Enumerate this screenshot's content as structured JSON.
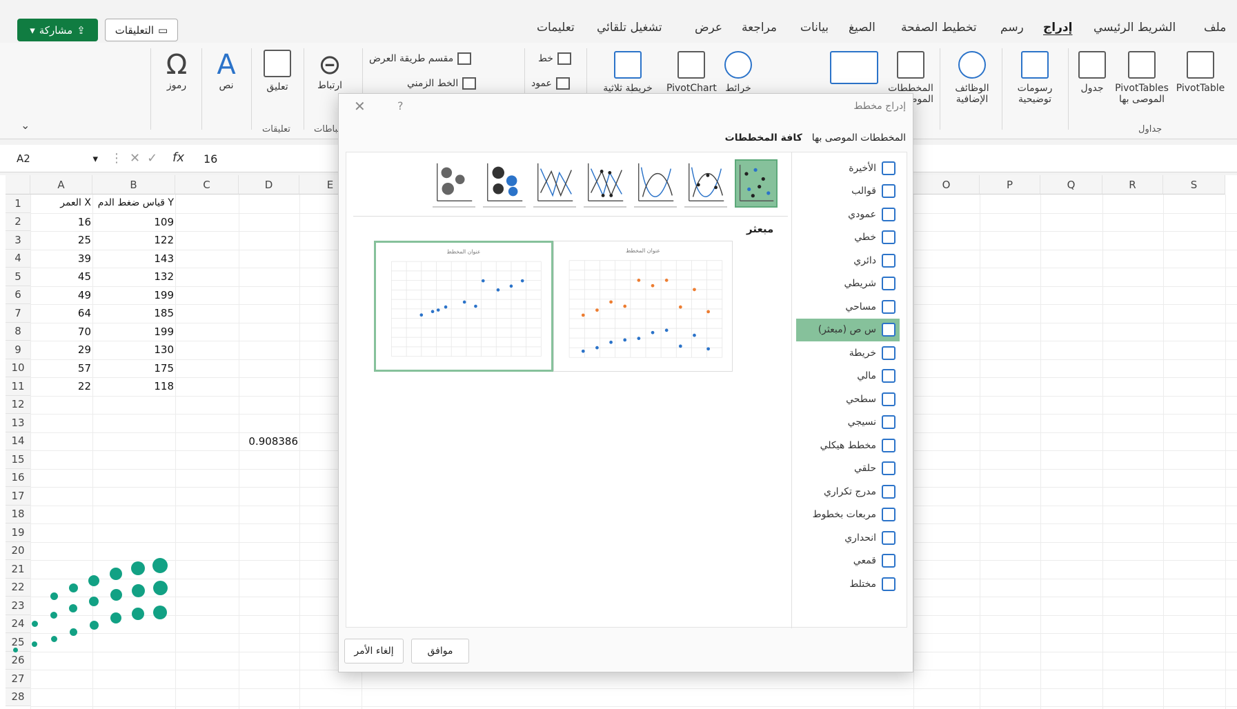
{
  "tabs": [
    "ملف",
    "الشريط الرئيسي",
    "إدراج",
    "رسم",
    "تخطيط الصفحة",
    "الصيغ",
    "بيانات",
    "مراجعة",
    "عرض",
    "تشغيل تلقائي",
    "تعليمات"
  ],
  "active_tab": "إدراج",
  "share_label": "مشاركة",
  "comments_label": "التعليقات",
  "ribbon": {
    "pivottable": "PivotTable",
    "rec_pivot": "PivotTables الموصى بها",
    "table": "جدول",
    "group_tables": "جداول",
    "illustrations": "رسومات توضيحية",
    "addins": "الوظائف الإضافية",
    "rec_charts": "المخططات الموصى بها",
    "maps": "خرائط",
    "pivotchart": "PivotChart",
    "map3d": "خريطة ثلاثية الأبعاد",
    "line_spark": "خط",
    "column_spark": "عمود",
    "slicer": "مقسم طريقة العرض",
    "timeline": "الخط الزمني",
    "link": "ارتباط",
    "comment": "تعليق",
    "group_comments": "تعليقات",
    "text": "نص",
    "symbols": "رموز",
    "group_links": "ارتباطات"
  },
  "formula": {
    "name_box": "A2",
    "value": "16"
  },
  "columns": [
    "A",
    "B",
    "C",
    "D",
    "E",
    "O",
    "P",
    "Q",
    "R",
    "S"
  ],
  "rows": [
    "1",
    "2",
    "3",
    "4",
    "5",
    "6",
    "7",
    "8",
    "9",
    "10",
    "11",
    "12",
    "13",
    "14",
    "15",
    "16",
    "17",
    "18",
    "19",
    "20",
    "21",
    "22",
    "23",
    "24",
    "25",
    "26",
    "27",
    "28"
  ],
  "sheet": {
    "header_a": "العمر X",
    "header_b": "قياس ضغط الدم Y",
    "col_a": [
      "16",
      "25",
      "39",
      "45",
      "49",
      "64",
      "70",
      "29",
      "57",
      "22"
    ],
    "col_b": [
      "109",
      "122",
      "143",
      "132",
      "199",
      "185",
      "199",
      "130",
      "175",
      "118"
    ],
    "d14": "0.908386"
  },
  "dialog": {
    "title": "إدراج مخطط",
    "help": "?",
    "tab_recommended": "المخططات الموصى بها",
    "tab_all": "كافة المخططات",
    "chart_types": [
      "الأخيرة",
      "قوالب",
      "عمودي",
      "خطي",
      "دائري",
      "شريطي",
      "مساحي",
      "س ص (مبعثر)",
      "خريطة",
      "مالي",
      "سطحي",
      "نسيجي",
      "مخطط هيكلي",
      "حلقي",
      "مدرج تكراري",
      "مربعات بخطوط",
      "انحداري",
      "قمعي",
      "مختلط"
    ],
    "selected_type": "س ص (مبعثر)",
    "section_title": "مبعثر",
    "preview_title": "عنوان المخطط",
    "ok": "موافق",
    "cancel": "إلغاء الأمر"
  },
  "chart_data": {
    "type": "scatter",
    "x": [
      16,
      25,
      39,
      45,
      49,
      64,
      70,
      29,
      57,
      22
    ],
    "y": [
      109,
      122,
      143,
      132,
      199,
      185,
      199,
      130,
      175,
      118
    ],
    "title": "عنوان المخطط"
  },
  "colors": {
    "accent_green": "#107c41",
    "selection": "#86c19b",
    "logo": "#12a184"
  }
}
